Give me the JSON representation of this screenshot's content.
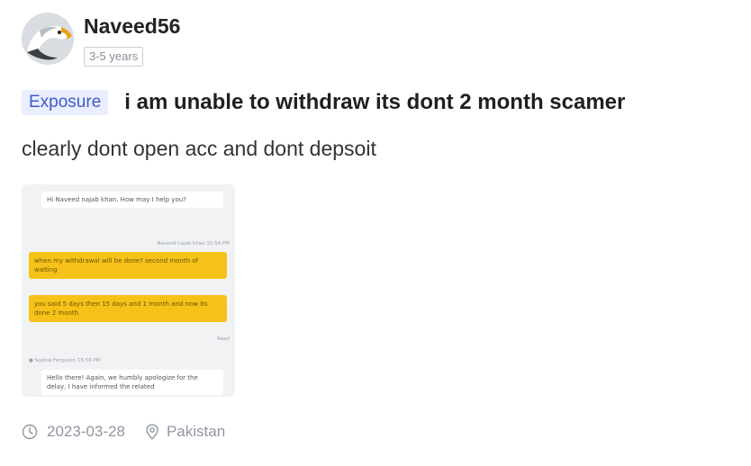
{
  "author": {
    "username": "Naveed56",
    "experience": "3-5 years"
  },
  "post": {
    "tag": "Exposure",
    "title": "i am unable to withdraw its dont 2 month scamer",
    "body": "clearly dont open acc and dont depsoit",
    "date": "2023-03-28",
    "location": "Pakistan"
  },
  "screenshot": {
    "agent_greeting": "Hi Naveed najab khan. How may I help you?",
    "user_meta": "Naveed najab khan 15:54 PM",
    "user_msg_1": "when my withdrawal will be done? second month of waiting",
    "user_msg_2": "you said 5 days then 15 days and 1 month and now its done 2 month",
    "read_label": "Read",
    "agent_meta": "Sophia Ferguson 15:56 PM",
    "agent_reply": "Hello there! Again, we humbly apologize for the delay, I have informed the related"
  },
  "colors": {
    "tag_bg": "#eaeefe",
    "tag_text": "#3e5ac8",
    "chat_user_bubble": "#f6c21a"
  }
}
